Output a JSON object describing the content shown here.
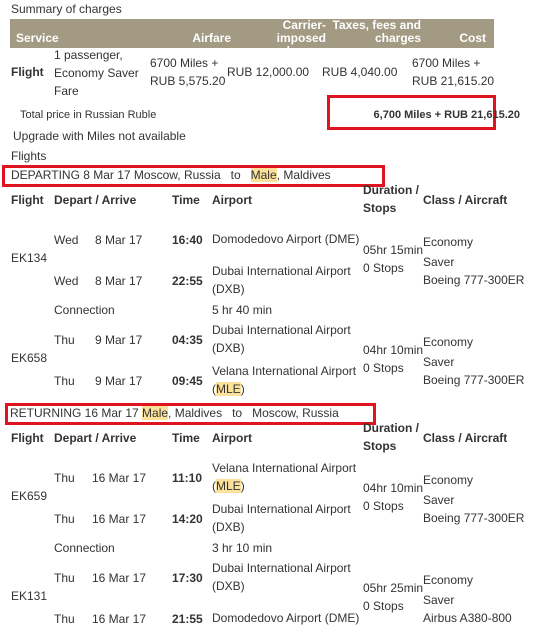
{
  "title": "Summary of charges",
  "charges": {
    "headers": {
      "service": "Service",
      "airfare": "Airfare",
      "carrier": "Carrier-imposed charges",
      "taxes": "Taxes, fees and charges",
      "cost": "Cost"
    },
    "row": {
      "service": "Flight",
      "description": "1 passenger, Economy Saver Fare",
      "airfare": "6700 Miles + RUB 5,575.20",
      "carrier": "RUB 12,000.00",
      "taxes": "RUB 4,040.00",
      "cost": "6700 Miles + RUB 21,615.20"
    },
    "total_label": "Total price in  Russian Ruble",
    "total_value": "6,700 Miles + RUB 21,615.20"
  },
  "upgrade_note": "Upgrade with Miles not available",
  "flights_label": "Flights",
  "columns": {
    "flight": "Flight",
    "depart_arrive": "Depart / Arrive",
    "time": "Time",
    "airport": "Airport",
    "duration": "Duration / Stops",
    "class": "Class / Aircraft"
  },
  "highlight_color": "#fbe19a",
  "box_color": "#e0141e",
  "sections": [
    {
      "direction": "DEPARTING",
      "date": "8 Mar 17",
      "from": "Moscow, Russia",
      "to_word": "to",
      "to_city": "Male",
      "to_country": ", Maldives",
      "segments": [
        {
          "flight": "EK134",
          "dep_day": "Wed",
          "dep_date": "8 Mar 17",
          "dep_time": "16:40",
          "dep_airport": "Domodedovo Airport (DME)",
          "arr_day": "Wed",
          "arr_date": "8 Mar 17",
          "arr_time": "22:55",
          "arr_airport": "Dubai International Airport (DXB)",
          "duration": "05hr 15min",
          "stops": "0 Stops",
          "class": "Economy Saver",
          "aircraft": "Boeing 777-300ER"
        },
        {
          "flight": "EK658",
          "dep_day": "Thu",
          "dep_date": "9 Mar 17",
          "dep_time": "04:35",
          "dep_airport": "Dubai International Airport (DXB)",
          "arr_day": "Thu",
          "arr_date": "9 Mar 17",
          "arr_time": "09:45",
          "arr_airport": "Velana International Airport (MLE)",
          "duration": "04hr 10min",
          "stops": "0 Stops",
          "class": "Economy Saver",
          "aircraft": "Boeing 777-300ER"
        }
      ],
      "connection_label": "Connection",
      "connection_time": "5 hr 40 min"
    },
    {
      "direction": "RETURNING",
      "date": "16 Mar 17",
      "from_city": "Male",
      "from_country": ", Maldives",
      "to_word": "to",
      "to": "Moscow, Russia",
      "segments": [
        {
          "flight": "EK659",
          "dep_day": "Thu",
          "dep_date": "16 Mar 17",
          "dep_time": "11:10",
          "dep_airport": "Velana International Airport (MLE)",
          "arr_day": "Thu",
          "arr_date": "16 Mar 17",
          "arr_time": "14:20",
          "arr_airport": "Dubai International Airport (DXB)",
          "duration": "04hr 10min",
          "stops": "0 Stops",
          "class": "Economy Saver",
          "aircraft": "Boeing 777-300ER"
        },
        {
          "flight": "EK131",
          "dep_day": "Thu",
          "dep_date": "16 Mar 17",
          "dep_time": "17:30",
          "dep_airport": "Dubai International Airport (DXB)",
          "arr_day": "Thu",
          "arr_date": "16 Mar 17",
          "arr_time": "21:55",
          "arr_airport": "Domodedovo Airport (DME)",
          "duration": "05hr 25min",
          "stops": "0 Stops",
          "class": "Economy Saver",
          "aircraft": "Airbus A380-800"
        }
      ],
      "connection_label": "Connection",
      "connection_time": "3 hr 10 min"
    }
  ]
}
